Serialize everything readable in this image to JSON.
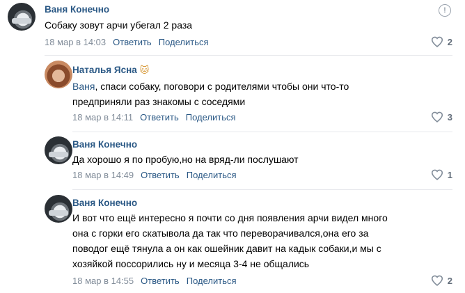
{
  "comments": [
    {
      "author": "Ваня Конечно",
      "text": "Собаку зовут арчи убегал 2 раза",
      "date": "18 мар в 14:03",
      "reply": "Ответить",
      "share": "Поделиться",
      "likes": "2"
    },
    {
      "author": "Наталья Ясна",
      "author_emoji": "🐱",
      "reply_to": "Ваня",
      "text": ", спаси собаку, поговори с родителями чтобы они что-то\nпредприняли раз знакомы с соседями",
      "date": "18 мар в 14:11",
      "reply": "Ответить",
      "share": "Поделиться",
      "likes": "3"
    },
    {
      "author": "Ваня Конечно",
      "text": "Да хорошо я по пробую,но на вряд-ли послушают",
      "date": "18 мар в 14:49",
      "reply": "Ответить",
      "share": "Поделиться",
      "likes": "1"
    },
    {
      "author": "Ваня Конечно",
      "text": "И вот что ещё интересно я почти со дня появления арчи видел много\nона с горки его скатывола да так что переворачивался,она его за\nповодог ещё тянула а он как ошейник давит на кадык собаки,и мы с\nхозяйкой поссорились ну и месяца 3-4 не общались",
      "date": "18 мар в 14:55",
      "reply": "Ответить",
      "share": "Поделиться",
      "likes": "2"
    }
  ],
  "icons": {
    "report": "exclamation-circle-icon",
    "like": "heart-outline-icon"
  },
  "colors": {
    "author": "#2a5885",
    "meta": "#818c99",
    "divider": "#e7e8ec"
  }
}
